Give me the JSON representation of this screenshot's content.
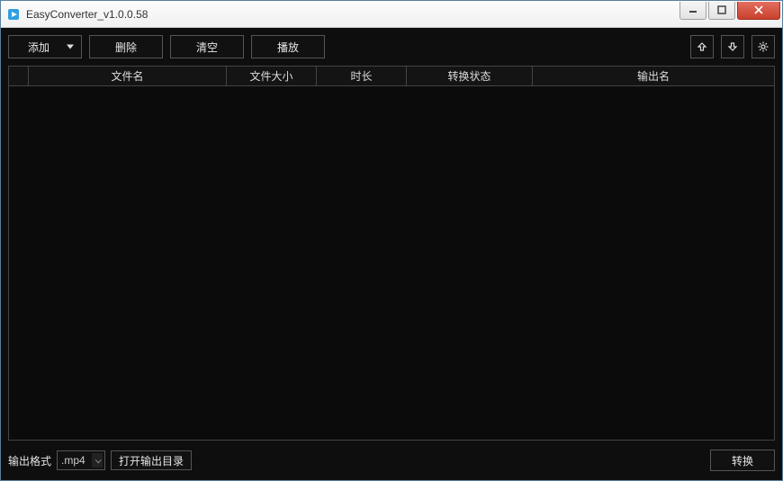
{
  "window": {
    "title": "EasyConverter_v1.0.0.58"
  },
  "toolbar": {
    "add": "添加",
    "remove": "删除",
    "clear": "清空",
    "play": "播放"
  },
  "columns": {
    "c0": "",
    "c1": "文件名",
    "c2": "文件大小",
    "c3": "时长",
    "c4": "转换状态",
    "c5": "输出名"
  },
  "footer": {
    "format_label": "输出格式",
    "format_value": ".mp4",
    "open_output": "打开输出目录",
    "convert": "转换"
  }
}
